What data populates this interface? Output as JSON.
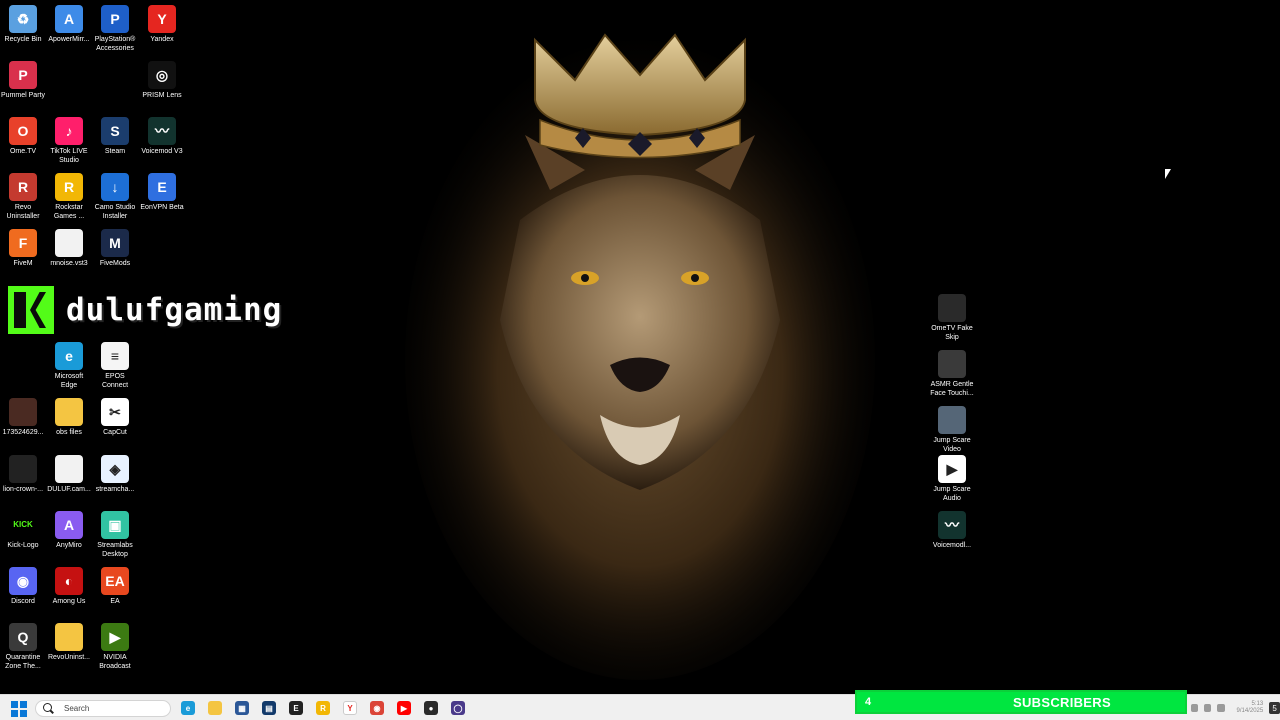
{
  "desktop": {
    "icons_left": [
      {
        "label": "Recycle Bin",
        "icon": "recycle-bin-icon",
        "color": "#5aa0e0",
        "glyph": "♻"
      },
      {
        "label": "ApowerMirr...",
        "icon": "apowermirror-icon",
        "color": "#3d8be8",
        "glyph": "A"
      },
      {
        "label": "PlayStation® Accessories",
        "icon": "playstation-icon",
        "color": "#1e5fc9",
        "glyph": "P"
      },
      {
        "label": "Yandex",
        "icon": "yandex-icon",
        "color": "#e52620",
        "glyph": "Y"
      },
      {
        "label": "Pummel Party",
        "icon": "pummel-party-icon",
        "color": "#d9304c",
        "glyph": "P"
      },
      {
        "label": "PRISM Lens",
        "icon": "prism-lens-icon",
        "color": "#111111",
        "glyph": "◎"
      },
      {
        "label": "Ome.TV",
        "icon": "ometv-icon",
        "color": "#e8412a",
        "glyph": "O"
      },
      {
        "label": "TikTok LIVE Studio",
        "icon": "tiktok-icon",
        "color": "#ff1f6b",
        "glyph": "♪"
      },
      {
        "label": "Steam",
        "icon": "steam-icon",
        "color": "#1b3d6d",
        "glyph": "S"
      },
      {
        "label": "Voicemod V3",
        "icon": "voicemod-icon",
        "color": "#12332e",
        "glyph": "〰"
      },
      {
        "label": "Revo Uninstaller",
        "icon": "revo-icon",
        "color": "#c43a2f",
        "glyph": "R"
      },
      {
        "label": "Rockstar Games ...",
        "icon": "rockstar-icon",
        "color": "#f2b705",
        "glyph": "R"
      },
      {
        "label": "Camo Studio Installer",
        "icon": "camo-icon",
        "color": "#1d6fd6",
        "glyph": "↓"
      },
      {
        "label": "EonVPN Beta",
        "icon": "eonvpn-icon",
        "color": "#2f6fe0",
        "glyph": "E"
      },
      {
        "label": "FiveM",
        "icon": "fivem-icon",
        "color": "#f06b1f",
        "glyph": "F"
      },
      {
        "label": "mnoise.vst3",
        "icon": "file-icon",
        "color": "#f2f2f2",
        "glyph": ""
      },
      {
        "label": "FiveMods",
        "icon": "fivemods-icon",
        "color": "#1b2a4a",
        "glyph": "M"
      },
      {
        "label": "Microsoft Edge",
        "icon": "edge-icon",
        "color": "#1a9bd8",
        "glyph": "e"
      },
      {
        "label": "EPOS Connect",
        "icon": "epos-icon",
        "color": "#f5f5f5",
        "glyph": "≡"
      },
      {
        "label": "173524629...",
        "icon": "image-file-icon",
        "color": "#4a2a22",
        "glyph": ""
      },
      {
        "label": "obs files",
        "icon": "folder-icon",
        "color": "#f4c542",
        "glyph": ""
      },
      {
        "label": "CapCut",
        "icon": "capcut-icon",
        "color": "#ffffff",
        "glyph": "✂"
      },
      {
        "label": "lion-crown-...",
        "icon": "image-file-icon",
        "color": "#222222",
        "glyph": ""
      },
      {
        "label": "DULUF.cam...",
        "icon": "file-icon",
        "color": "#f2f2f2",
        "glyph": ""
      },
      {
        "label": "streamcha...",
        "icon": "streamchat-icon",
        "color": "#e8f2ff",
        "glyph": "◈"
      },
      {
        "label": "Kick-Logo",
        "icon": "kick-icon",
        "color": "#000000",
        "glyph": "KICK"
      },
      {
        "label": "AnyMiro",
        "icon": "anymiro-icon",
        "color": "#8a5cf0",
        "glyph": "A"
      },
      {
        "label": "Streamlabs Desktop",
        "icon": "streamlabs-icon",
        "color": "#31c3a2",
        "glyph": "▣"
      },
      {
        "label": "Discord",
        "icon": "discord-icon",
        "color": "#5865f2",
        "glyph": "◉"
      },
      {
        "label": "Among Us",
        "icon": "among-us-icon",
        "color": "#c51111",
        "glyph": "◐"
      },
      {
        "label": "EA",
        "icon": "ea-icon",
        "color": "#e8481f",
        "glyph": "EA"
      },
      {
        "label": "Quarantine Zone The...",
        "icon": "quarantine-zone-icon",
        "color": "#3a3a3a",
        "glyph": "Q"
      },
      {
        "label": "RevoUninst...",
        "icon": "folder-icon",
        "color": "#f4c542",
        "glyph": ""
      },
      {
        "label": "NVIDIA Broadcast",
        "icon": "nvidia-icon",
        "color": "#3c7a12",
        "glyph": "▶"
      }
    ],
    "icons_right": [
      {
        "label": "OmeTV Fake Skip",
        "icon": "video-file-icon",
        "color": "#2a2a2a",
        "glyph": ""
      },
      {
        "label": "ASMR Gentle Face Touchi...",
        "icon": "video-file-icon",
        "color": "#3a3a3a",
        "glyph": ""
      },
      {
        "label": "Jump Scare Video",
        "icon": "video-file-icon",
        "color": "#556677",
        "glyph": ""
      },
      {
        "label": "Jump Scare Audio",
        "icon": "audio-file-icon",
        "color": "#ffffff",
        "glyph": "▶"
      },
      {
        "label": "Voicemodl...",
        "icon": "voicemod-icon",
        "color": "#12332e",
        "glyph": "〰"
      }
    ]
  },
  "overlay": {
    "channel_name": "dulufgaming",
    "brand_color": "#53fc18"
  },
  "taskbar": {
    "search_placeholder": "Search",
    "apps": [
      {
        "icon": "edge-icon",
        "color": "#1a9bd8",
        "glyph": "e"
      },
      {
        "icon": "file-explorer-icon",
        "color": "#f4c542",
        "glyph": ""
      },
      {
        "icon": "store-icon",
        "color": "#2b5797",
        "glyph": "▦"
      },
      {
        "icon": "app-icon",
        "color": "#123a6b",
        "glyph": "▤"
      },
      {
        "icon": "epic-games-icon",
        "color": "#222222",
        "glyph": "E"
      },
      {
        "icon": "rockstar-icon",
        "color": "#f2b705",
        "glyph": "R"
      },
      {
        "icon": "yandex-icon",
        "color": "#ffffff",
        "glyph": "Y"
      },
      {
        "icon": "chrome-icon",
        "color": "#db4437",
        "glyph": "◉"
      },
      {
        "icon": "youtube-icon",
        "color": "#ff0000",
        "glyph": "▶"
      },
      {
        "icon": "obs-icon",
        "color": "#2a2a2a",
        "glyph": "●"
      },
      {
        "icon": "app-circle-icon",
        "color": "#4a3a8a",
        "glyph": "◯"
      }
    ]
  },
  "subscriber_banner": {
    "count": "4",
    "label": "SUBSCRIBERS",
    "color": "#00e640"
  },
  "tray": {
    "time": "5:13",
    "date": "9/14/2025",
    "notifications": "5"
  }
}
